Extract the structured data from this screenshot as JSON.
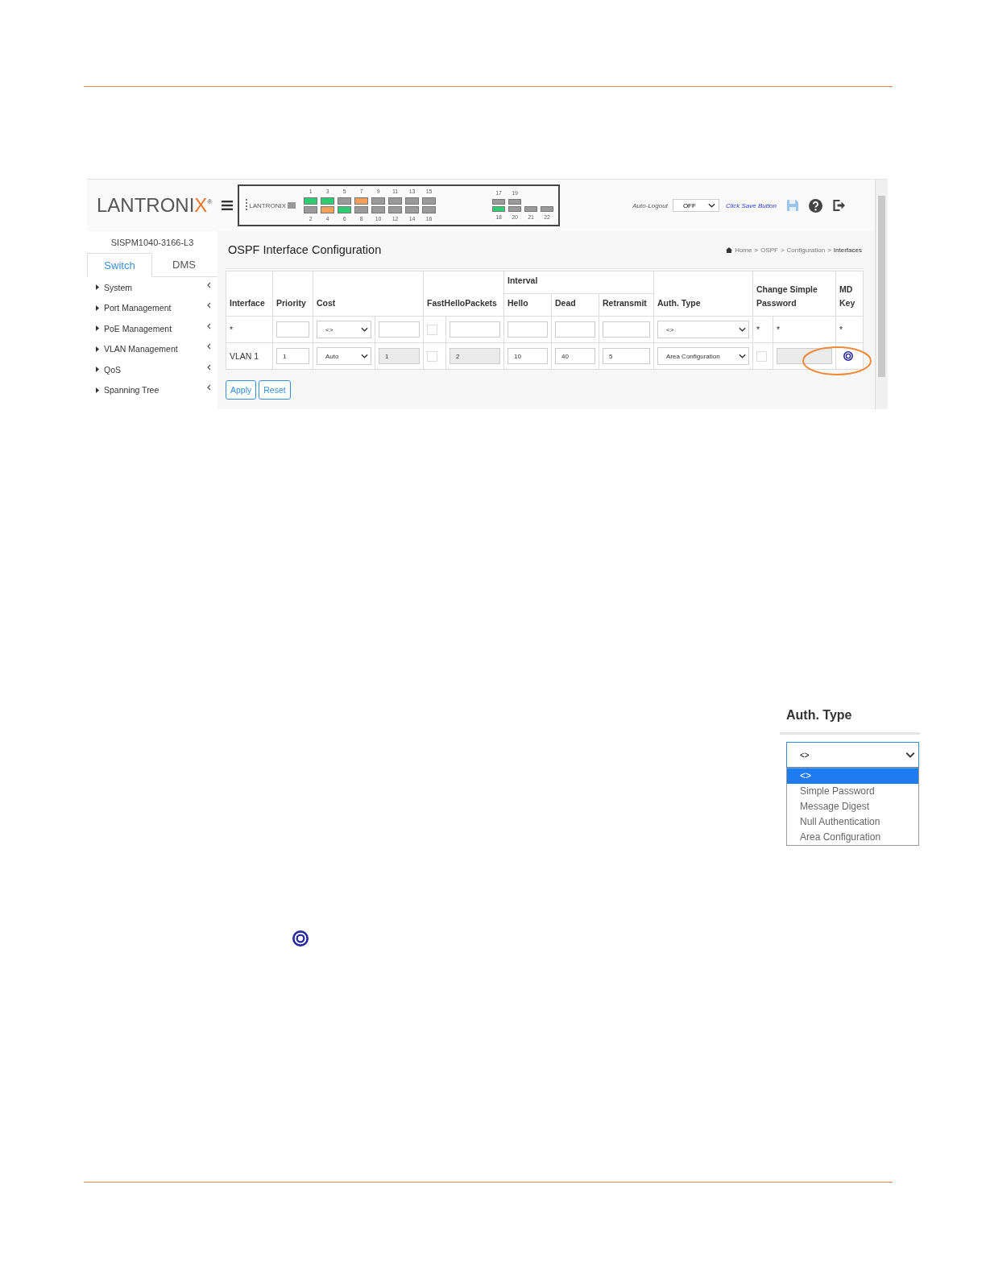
{
  "logo": {
    "text": "LANTRONIX",
    "mark": "®"
  },
  "port_panel": {
    "brand": "LANTRONIX",
    "top_ports": [
      {
        "label": "1",
        "color": "#2ecc71"
      },
      {
        "label": "3",
        "color": "#2ecc71"
      },
      {
        "label": "5",
        "color": "#9a9a9a"
      },
      {
        "label": "7",
        "color": "#f5a05a"
      },
      {
        "label": "9",
        "color": "#9a9a9a"
      },
      {
        "label": "11",
        "color": "#9a9a9a"
      },
      {
        "label": "13",
        "color": "#9a9a9a"
      },
      {
        "label": "15",
        "color": "#9a9a9a"
      }
    ],
    "bottom_ports": [
      {
        "label": "2",
        "color": "#9a9a9a"
      },
      {
        "label": "4",
        "color": "#f5a05a"
      },
      {
        "label": "6",
        "color": "#2ecc71"
      },
      {
        "label": "8",
        "color": "#9a9a9a"
      },
      {
        "label": "10",
        "color": "#9a9a9a"
      },
      {
        "label": "12",
        "color": "#9a9a9a"
      },
      {
        "label": "14",
        "color": "#9a9a9a"
      },
      {
        "label": "16",
        "color": "#9a9a9a"
      }
    ],
    "sfp_top": [
      {
        "label": "17",
        "color": "#9a9a9a"
      },
      {
        "label": "19",
        "color": "#9a9a9a"
      }
    ],
    "sfp_bottom": [
      {
        "label": "18",
        "color": "#2ecc71"
      },
      {
        "label": "20",
        "color": "#9a9a9a"
      }
    ],
    "small_ports": [
      {
        "label": "21"
      },
      {
        "label": "22"
      }
    ]
  },
  "header": {
    "auto_logout_label": "Auto-Logout",
    "auto_logout_value": "OFF",
    "save_hint": "Click Save Button"
  },
  "sidebar": {
    "model": "SISPM1040-3166-L3",
    "tabs": [
      {
        "label": "Switch",
        "selected": true
      },
      {
        "label": "DMS",
        "selected": false
      }
    ],
    "items": [
      {
        "label": "System"
      },
      {
        "label": "Port Management"
      },
      {
        "label": "PoE Management"
      },
      {
        "label": "VLAN Management"
      },
      {
        "label": "QoS"
      },
      {
        "label": "Spanning Tree"
      }
    ]
  },
  "page": {
    "title": "OSPF Interface Configuration",
    "breadcrumb": [
      "Home",
      "OSPF",
      "Configuration",
      "Interfaces"
    ],
    "separator": ">"
  },
  "table": {
    "columns": [
      {
        "label": "Interface"
      },
      {
        "label": "Priority"
      },
      {
        "label": "Cost",
        "colspan": 2
      },
      {
        "label": "FastHelloPackets",
        "colspan": 2
      },
      {
        "label": "Interval",
        "colspan": 3,
        "children": [
          {
            "label": "Hello"
          },
          {
            "label": "Dead"
          },
          {
            "label": "Retransmit"
          }
        ]
      },
      {
        "label": "Auth. Type"
      },
      {
        "label": "Change Simple Password",
        "colspan": 2
      },
      {
        "label": "MD Key"
      }
    ],
    "rows": [
      {
        "cells": [
          {
            "kind": "text",
            "value": "*"
          },
          {
            "kind": "input",
            "disabled": false
          },
          {
            "kind": "select",
            "value": "<>"
          },
          {
            "kind": "input",
            "disabled": false
          },
          {
            "kind": "checkbox",
            "checked": false
          },
          {
            "kind": "input",
            "disabled": false
          },
          {
            "kind": "input",
            "disabled": false
          },
          {
            "kind": "input",
            "disabled": false
          },
          {
            "kind": "input",
            "disabled": false
          },
          {
            "kind": "select",
            "value": "<>"
          },
          {
            "kind": "text",
            "value": "*"
          },
          {
            "kind": "text",
            "value": "*"
          },
          {
            "kind": "text",
            "value": "*"
          }
        ]
      },
      {
        "cells": [
          {
            "kind": "text",
            "value": "VLAN 1"
          },
          {
            "kind": "input",
            "value": "1",
            "disabled": false
          },
          {
            "kind": "select",
            "value": "Auto"
          },
          {
            "kind": "input",
            "value": "1",
            "disabled": true
          },
          {
            "kind": "checkbox",
            "checked": false
          },
          {
            "kind": "input",
            "value": "2",
            "disabled": true
          },
          {
            "kind": "input",
            "value": "10",
            "disabled": false
          },
          {
            "kind": "input",
            "value": "40",
            "disabled": false
          },
          {
            "kind": "input",
            "value": "5",
            "disabled": false
          },
          {
            "kind": "select",
            "value": "Area Configuration"
          },
          {
            "kind": "checkbox",
            "checked": false
          },
          {
            "kind": "input",
            "disabled": true
          },
          {
            "kind": "key"
          }
        ]
      }
    ]
  },
  "buttons": [
    "Apply",
    "Reset"
  ],
  "auth_type_dropdown": {
    "heading": "Auth. Type",
    "value": "<>",
    "options": [
      {
        "label": "<>",
        "selected": true
      },
      {
        "label": "Simple Password",
        "selected": false
      },
      {
        "label": "Message Digest",
        "selected": false
      },
      {
        "label": "Null Authentication",
        "selected": false
      },
      {
        "label": "Area Configuration",
        "selected": false
      }
    ]
  }
}
